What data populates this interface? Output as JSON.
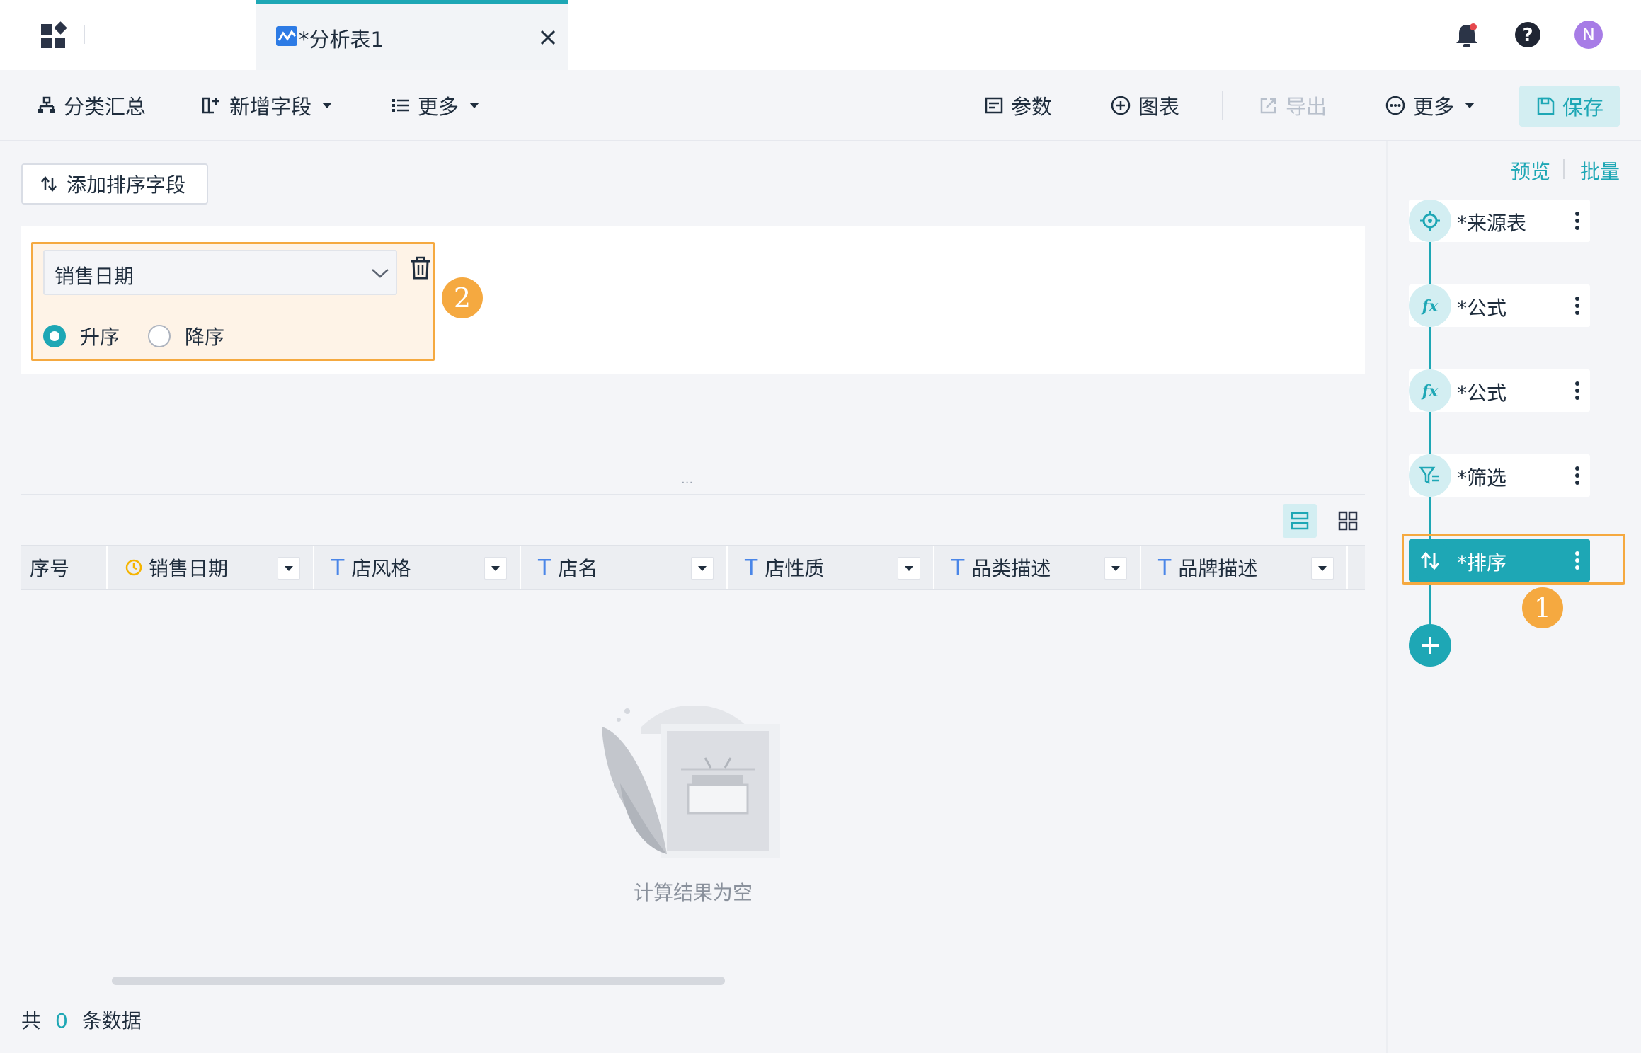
{
  "topbar": {
    "tab_title": "*分析表1",
    "avatar_letter": "N"
  },
  "toolbar": {
    "group_summary": "分类汇总",
    "add_field": "新增字段",
    "more_left": "更多",
    "params": "参数",
    "chart": "图表",
    "export": "导出",
    "more_right": "更多",
    "save": "保存"
  },
  "sort_editor": {
    "add_sort_field": "添加排序字段",
    "field": "销售日期",
    "ascending": "升序",
    "descending": "降序",
    "selected_order": "升序"
  },
  "table": {
    "columns": [
      {
        "label": "序号",
        "type_icon": ""
      },
      {
        "label": "销售日期",
        "type_icon": "clock-icon"
      },
      {
        "label": "店风格",
        "type_icon": "T"
      },
      {
        "label": "店名",
        "type_icon": "T"
      },
      {
        "label": "店性质",
        "type_icon": "T"
      },
      {
        "label": "品类描述",
        "type_icon": "T"
      },
      {
        "label": "品牌描述",
        "type_icon": "T"
      }
    ],
    "empty_text": "计算结果为空"
  },
  "footer": {
    "prefix": "共",
    "count": "0",
    "suffix": "条数据"
  },
  "steps": {
    "preview": "预览",
    "batch": "批量",
    "items": [
      {
        "label": "*来源表",
        "icon": "crosshair-icon"
      },
      {
        "label": "*公式",
        "icon": "fx-icon"
      },
      {
        "label": "*公式",
        "icon": "fx-icon"
      },
      {
        "label": "*筛选",
        "icon": "filter-icon"
      },
      {
        "label": "*排序",
        "icon": "sort-icon",
        "active": true
      }
    ]
  },
  "callouts": {
    "one": "1",
    "two": "2"
  },
  "colors": {
    "accent": "#1ea7b5",
    "highlight": "#f5a940",
    "avatar": "#a77ce6"
  }
}
